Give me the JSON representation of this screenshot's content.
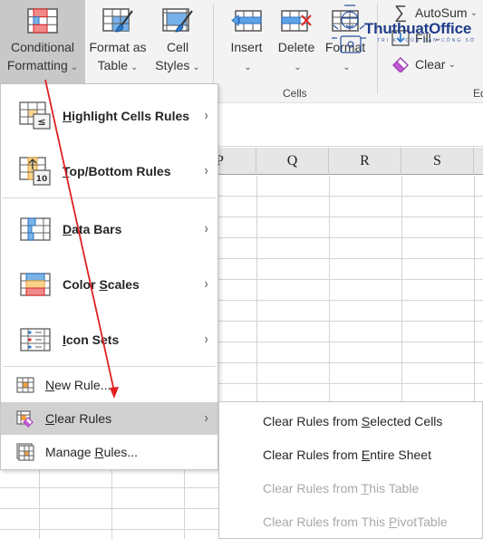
{
  "ribbon": {
    "buttons": [
      {
        "line1": "Conditional",
        "line2": "Formatting",
        "active": true
      },
      {
        "line1": "Format as",
        "line2": "Table"
      },
      {
        "line1": "Cell",
        "line2": "Styles"
      },
      {
        "line1": "Insert",
        "line2": ""
      },
      {
        "line1": "Delete",
        "line2": ""
      },
      {
        "line1": "Format",
        "line2": ""
      }
    ],
    "cells_group_label": "Cells",
    "editing": {
      "autosum": "AutoSum",
      "fill": "Fill",
      "clear": "Clear",
      "group_label_partial": "Ed"
    },
    "chevron": "⌄"
  },
  "watermark": {
    "text": "ThuthuatOffice",
    "subtext": "TRI KỶ CỦA DÂN CÔNG SỞ"
  },
  "sheet": {
    "columns": [
      "P",
      "Q",
      "R",
      "S"
    ]
  },
  "menu": {
    "items": [
      {
        "label_pre": "",
        "accel": "H",
        "label_post": "ighlight Cells Rules",
        "icon": "highlight-cells-icon",
        "submenu": true
      },
      {
        "label_pre": "",
        "accel": "T",
        "label_post": "op/Bottom Rules",
        "icon": "top-bottom-icon",
        "submenu": true
      },
      {
        "label_pre": "",
        "accel": "D",
        "label_post": "ata Bars",
        "icon": "data-bars-icon",
        "submenu": true
      },
      {
        "label_pre": "Color ",
        "accel": "S",
        "label_post": "cales",
        "icon": "color-scales-icon",
        "submenu": true
      },
      {
        "label_pre": "",
        "accel": "I",
        "label_post": "con Sets",
        "icon": "icon-sets-icon",
        "submenu": true
      },
      {
        "label_pre": "",
        "accel": "N",
        "label_post": "ew Rule...",
        "icon": "new-rule-icon",
        "submenu": false
      },
      {
        "label_pre": "",
        "accel": "C",
        "label_post": "lear Rules",
        "icon": "clear-rules-icon",
        "submenu": true,
        "hovered": true
      },
      {
        "label_pre": "Manage ",
        "accel": "R",
        "label_post": "ules...",
        "icon": "manage-rules-icon",
        "submenu": false
      }
    ],
    "arrow": "›"
  },
  "submenu": {
    "items": [
      {
        "pre": "Clear Rules from ",
        "accel": "S",
        "post": "elected Cells",
        "enabled": true
      },
      {
        "pre": "Clear Rules from ",
        "accel": "E",
        "post": "ntire Sheet",
        "enabled": true
      },
      {
        "pre": "Clear Rules from ",
        "accel": "T",
        "post": "his Table",
        "enabled": false
      },
      {
        "pre": "Clear Rules from This ",
        "accel": "P",
        "post": "ivotTable",
        "enabled": false
      }
    ]
  },
  "colors": {
    "accent_red": "#e02020",
    "hover_bg": "#d1d1d1",
    "disabled_text": "#a8a8a8"
  }
}
